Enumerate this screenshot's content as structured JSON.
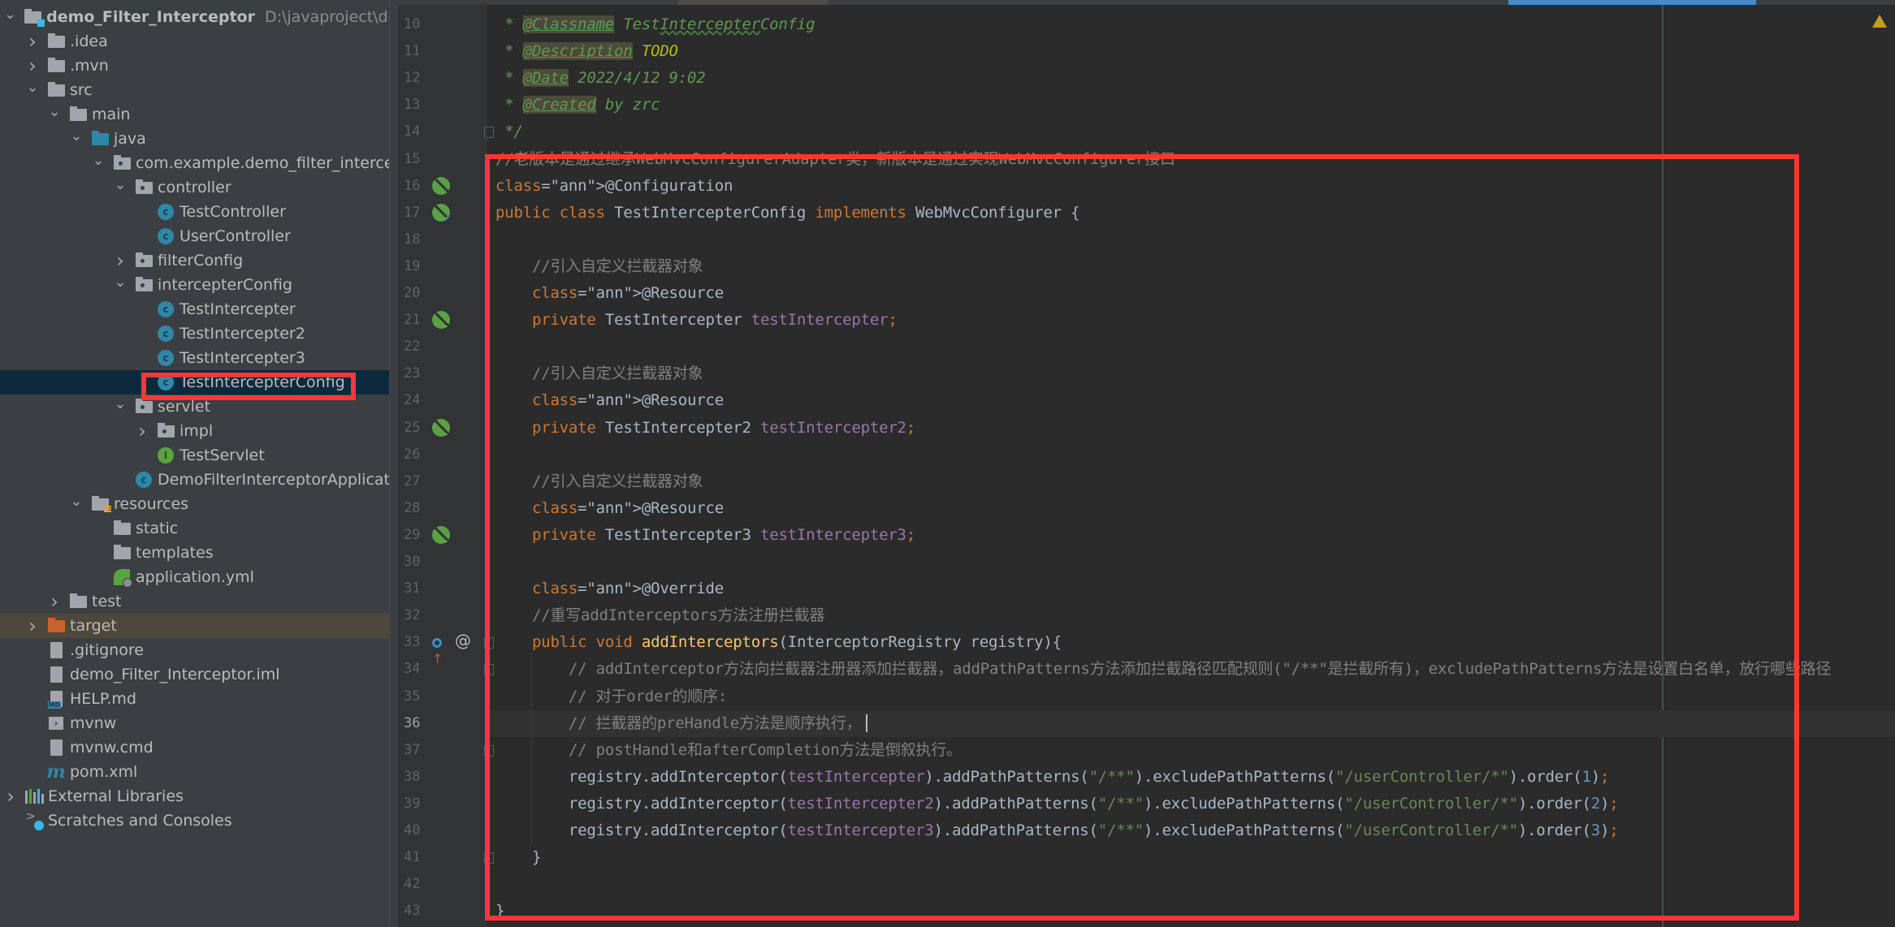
{
  "project_tree": {
    "root": {
      "name": "demo_Filter_Interceptor",
      "path": "D:\\javaproject\\demo_Filt"
    },
    "items": [
      {
        "label": ".idea",
        "type": "folder",
        "depth": 1,
        "expanded": false
      },
      {
        "label": ".mvn",
        "type": "folder",
        "depth": 1,
        "expanded": false
      },
      {
        "label": "src",
        "type": "folder",
        "depth": 1,
        "expanded": true
      },
      {
        "label": "main",
        "type": "folder",
        "depth": 2,
        "expanded": true
      },
      {
        "label": "java",
        "type": "source-folder",
        "depth": 3,
        "expanded": true
      },
      {
        "label": "com.example.demo_filter_interceptor",
        "type": "package",
        "depth": 4,
        "expanded": true
      },
      {
        "label": "controller",
        "type": "package",
        "depth": 5,
        "expanded": true
      },
      {
        "label": "TestController",
        "type": "class",
        "depth": 6
      },
      {
        "label": "UserController",
        "type": "class",
        "depth": 6
      },
      {
        "label": "filterConfig",
        "type": "package",
        "depth": 5,
        "expanded": false
      },
      {
        "label": "intercepterConfig",
        "type": "package",
        "depth": 5,
        "expanded": true
      },
      {
        "label": "TestIntercepter",
        "type": "class",
        "depth": 6
      },
      {
        "label": "TestIntercepter2",
        "type": "class",
        "depth": 6
      },
      {
        "label": "TestIntercepter3",
        "type": "class",
        "depth": 6
      },
      {
        "label": "TestIntercepterConfig",
        "type": "class",
        "depth": 6,
        "selected": true
      },
      {
        "label": "servlet",
        "type": "package",
        "depth": 5,
        "expanded": true
      },
      {
        "label": "impl",
        "type": "package",
        "depth": 6,
        "expanded": false
      },
      {
        "label": "TestServlet",
        "type": "interface",
        "depth": 6
      },
      {
        "label": "DemoFilterInterceptorApplication",
        "type": "spring-app",
        "depth": 5
      },
      {
        "label": "resources",
        "type": "resources-folder",
        "depth": 3,
        "expanded": true
      },
      {
        "label": "static",
        "type": "folder",
        "depth": 4
      },
      {
        "label": "templates",
        "type": "folder",
        "depth": 4
      },
      {
        "label": "application.yml",
        "type": "spring-config",
        "depth": 4
      },
      {
        "label": "test",
        "type": "folder",
        "depth": 2,
        "expanded": false
      },
      {
        "label": "target",
        "type": "excluded-folder",
        "depth": 1,
        "expanded": false
      },
      {
        "label": ".gitignore",
        "type": "ignore-file",
        "depth": 1
      },
      {
        "label": "demo_Filter_Interceptor.iml",
        "type": "iml-file",
        "depth": 1
      },
      {
        "label": "HELP.md",
        "type": "md-file",
        "depth": 1
      },
      {
        "label": "mvnw",
        "type": "shell-file",
        "depth": 1
      },
      {
        "label": "mvnw.cmd",
        "type": "text-file",
        "depth": 1
      },
      {
        "label": "pom.xml",
        "type": "maven-file",
        "depth": 1
      },
      {
        "label": "External Libraries",
        "type": "libraries",
        "depth": 0,
        "expanded": false
      },
      {
        "label": "Scratches and Consoles",
        "type": "scratches",
        "depth": 0
      }
    ]
  },
  "editor": {
    "current_line": 36,
    "lines": [
      {
        "n": 10,
        "text": " * @Classname TestIntercepterConfig"
      },
      {
        "n": 11,
        "text": " * @Description TODO"
      },
      {
        "n": 12,
        "text": " * @Date 2022/4/12 9:02"
      },
      {
        "n": 13,
        "text": " * @Created by zrc"
      },
      {
        "n": 14,
        "text": " */"
      },
      {
        "n": 15,
        "text": "//老版本是通过继承WebMvcConfigurerAdapter类，新版本是通过实现WebMvcConfigurer接口"
      },
      {
        "n": 16,
        "text": "@Configuration"
      },
      {
        "n": 17,
        "text": "public class TestIntercepterConfig implements WebMvcConfigurer {"
      },
      {
        "n": 18,
        "text": ""
      },
      {
        "n": 19,
        "text": "    //引入自定义拦截器对象"
      },
      {
        "n": 20,
        "text": "    @Resource"
      },
      {
        "n": 21,
        "text": "    private TestIntercepter testIntercepter;"
      },
      {
        "n": 22,
        "text": ""
      },
      {
        "n": 23,
        "text": "    //引入自定义拦截器对象"
      },
      {
        "n": 24,
        "text": "    @Resource"
      },
      {
        "n": 25,
        "text": "    private TestIntercepter2 testIntercepter2;"
      },
      {
        "n": 26,
        "text": ""
      },
      {
        "n": 27,
        "text": "    //引入自定义拦截器对象"
      },
      {
        "n": 28,
        "text": "    @Resource"
      },
      {
        "n": 29,
        "text": "    private TestIntercepter3 testIntercepter3;"
      },
      {
        "n": 30,
        "text": ""
      },
      {
        "n": 31,
        "text": "    @Override"
      },
      {
        "n": 32,
        "text": "    //重写addInterceptors方法注册拦截器"
      },
      {
        "n": 33,
        "text": "    public void addInterceptors(InterceptorRegistry registry){"
      },
      {
        "n": 34,
        "text": "        // addInterceptor方法向拦截器注册器添加拦截器，addPathPatterns方法添加拦截路径匹配规则(\"/**\"是拦截所有)，excludePathPatterns方法是设置白名单，放行哪些路径"
      },
      {
        "n": 35,
        "text": "        // 对于order的顺序:"
      },
      {
        "n": 36,
        "text": "        // 拦截器的preHandle方法是顺序执行，"
      },
      {
        "n": 37,
        "text": "        // postHandle和afterCompletion方法是倒叙执行。"
      },
      {
        "n": 38,
        "text": "        registry.addInterceptor(testIntercepter).addPathPatterns(\"/**\").excludePathPatterns(\"/userController/*\").order(1);"
      },
      {
        "n": 39,
        "text": "        registry.addInterceptor(testIntercepter2).addPathPatterns(\"/**\").excludePathPatterns(\"/userController/*\").order(2);"
      },
      {
        "n": 40,
        "text": "        registry.addInterceptor(testIntercepter3).addPathPatterns(\"/**\").excludePathPatterns(\"/userController/*\").order(3);"
      },
      {
        "n": 41,
        "text": "    }"
      },
      {
        "n": 42,
        "text": ""
      },
      {
        "n": 43,
        "text": "}"
      }
    ],
    "gutter_icons": [
      {
        "line": 16,
        "icon": "spring-configuration-icon"
      },
      {
        "line": 17,
        "icon": "spring-bean-class-icon"
      },
      {
        "line": 21,
        "icon": "spring-autowired-icon"
      },
      {
        "line": 25,
        "icon": "spring-autowired-icon"
      },
      {
        "line": 29,
        "icon": "spring-autowired-icon"
      },
      {
        "line": 33,
        "icon": "implements-method-icon"
      }
    ],
    "status": {
      "inspection": "warning"
    }
  },
  "annotations": {
    "highlight_color": "#fc3737"
  }
}
